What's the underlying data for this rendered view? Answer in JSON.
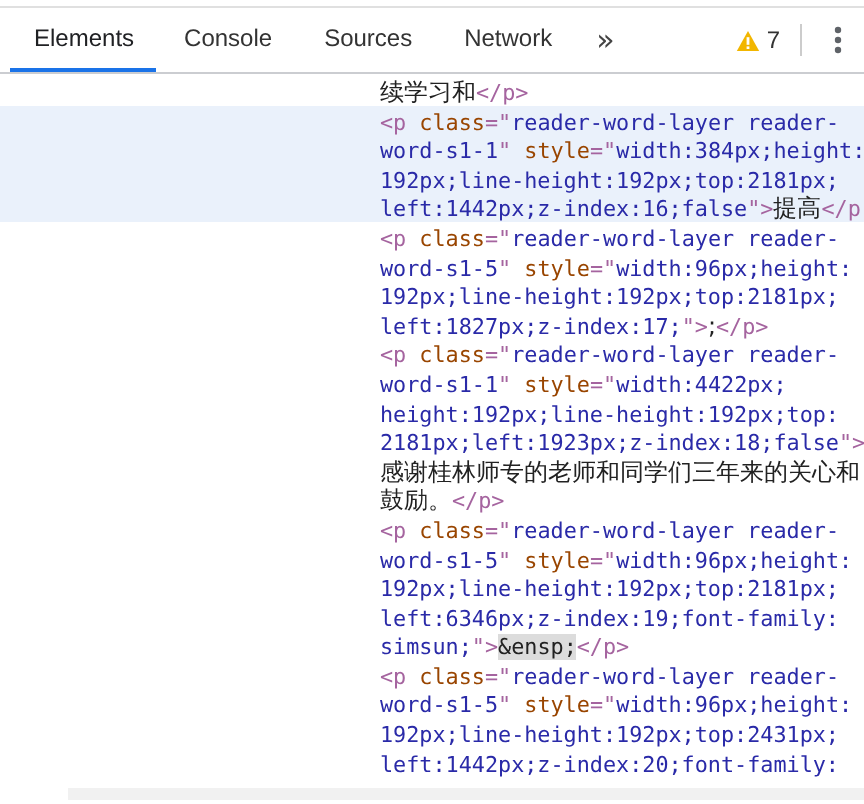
{
  "tabs": [
    {
      "label": "Elements",
      "selected": true
    },
    {
      "label": "Console",
      "selected": false
    },
    {
      "label": "Sources",
      "selected": false
    },
    {
      "label": "Network",
      "selected": false
    }
  ],
  "overflow_button": "»",
  "warnings": {
    "count": "7"
  },
  "nodes": [
    {
      "selected": false,
      "lines": [
        [
          {
            "kind": "text",
            "text": "续学习和"
          },
          {
            "kind": "tag",
            "text": "</p>"
          }
        ]
      ]
    },
    {
      "selected": true,
      "lines": [
        [
          {
            "kind": "tag",
            "text": "<p "
          },
          {
            "kind": "attr",
            "text": "class"
          },
          {
            "kind": "tag",
            "text": "=\""
          },
          {
            "kind": "val",
            "text": "reader-word-layer reader-"
          }
        ],
        [
          {
            "kind": "val",
            "text": "word-s1-1"
          },
          {
            "kind": "tag",
            "text": "\" "
          },
          {
            "kind": "attr",
            "text": "style"
          },
          {
            "kind": "tag",
            "text": "=\""
          },
          {
            "kind": "val",
            "text": "width:384px;height:"
          }
        ],
        [
          {
            "kind": "val",
            "text": "192px;line-height:192px;top:2181px;"
          }
        ],
        [
          {
            "kind": "val",
            "text": "left:1442px;z-index:16;false"
          },
          {
            "kind": "tag",
            "text": "\">"
          },
          {
            "kind": "text",
            "text": "提高"
          },
          {
            "kind": "tag",
            "text": "</p"
          }
        ]
      ]
    },
    {
      "selected": false,
      "lines": [
        [
          {
            "kind": "tag",
            "text": "<p "
          },
          {
            "kind": "attr",
            "text": "class"
          },
          {
            "kind": "tag",
            "text": "=\""
          },
          {
            "kind": "val",
            "text": "reader-word-layer reader-"
          }
        ],
        [
          {
            "kind": "val",
            "text": "word-s1-5"
          },
          {
            "kind": "tag",
            "text": "\" "
          },
          {
            "kind": "attr",
            "text": "style"
          },
          {
            "kind": "tag",
            "text": "=\""
          },
          {
            "kind": "val",
            "text": "width:96px;height:"
          }
        ],
        [
          {
            "kind": "val",
            "text": "192px;line-height:192px;top:2181px;"
          }
        ],
        [
          {
            "kind": "val",
            "text": "left:1827px;z-index:17;"
          },
          {
            "kind": "tag",
            "text": "\">"
          },
          {
            "kind": "text",
            "text": ";"
          },
          {
            "kind": "tag",
            "text": "</p>"
          }
        ]
      ]
    },
    {
      "selected": false,
      "lines": [
        [
          {
            "kind": "tag",
            "text": "<p "
          },
          {
            "kind": "attr",
            "text": "class"
          },
          {
            "kind": "tag",
            "text": "=\""
          },
          {
            "kind": "val",
            "text": "reader-word-layer reader-"
          }
        ],
        [
          {
            "kind": "val",
            "text": "word-s1-1"
          },
          {
            "kind": "tag",
            "text": "\" "
          },
          {
            "kind": "attr",
            "text": "style"
          },
          {
            "kind": "tag",
            "text": "=\""
          },
          {
            "kind": "val",
            "text": "width:4422px;"
          }
        ],
        [
          {
            "kind": "val",
            "text": "height:192px;line-height:192px;top:"
          }
        ],
        [
          {
            "kind": "val",
            "text": "2181px;left:1923px;z-index:18;false"
          },
          {
            "kind": "tag",
            "text": "\">"
          }
        ],
        [
          {
            "kind": "text",
            "text": "感谢桂林师专的老师和同学们三年来的关心和"
          }
        ],
        [
          {
            "kind": "text",
            "text": "鼓励。"
          },
          {
            "kind": "tag",
            "text": "</p>"
          }
        ]
      ]
    },
    {
      "selected": false,
      "lines": [
        [
          {
            "kind": "tag",
            "text": "<p "
          },
          {
            "kind": "attr",
            "text": "class"
          },
          {
            "kind": "tag",
            "text": "=\""
          },
          {
            "kind": "val",
            "text": "reader-word-layer reader-"
          }
        ],
        [
          {
            "kind": "val",
            "text": "word-s1-5"
          },
          {
            "kind": "tag",
            "text": "\" "
          },
          {
            "kind": "attr",
            "text": "style"
          },
          {
            "kind": "tag",
            "text": "=\""
          },
          {
            "kind": "val",
            "text": "width:96px;height:"
          }
        ],
        [
          {
            "kind": "val",
            "text": "192px;line-height:192px;top:2181px;"
          }
        ],
        [
          {
            "kind": "val",
            "text": "left:6346px;z-index:19;font-family:"
          }
        ],
        [
          {
            "kind": "val",
            "text": "simsun;"
          },
          {
            "kind": "tag",
            "text": "\">"
          },
          {
            "kind": "entity",
            "text": "&ensp;"
          },
          {
            "kind": "tag",
            "text": "</p>"
          }
        ]
      ]
    },
    {
      "selected": false,
      "lines": [
        [
          {
            "kind": "tag",
            "text": "<p "
          },
          {
            "kind": "attr",
            "text": "class"
          },
          {
            "kind": "tag",
            "text": "=\""
          },
          {
            "kind": "val",
            "text": "reader-word-layer reader-"
          }
        ],
        [
          {
            "kind": "val",
            "text": "word-s1-5"
          },
          {
            "kind": "tag",
            "text": "\" "
          },
          {
            "kind": "attr",
            "text": "style"
          },
          {
            "kind": "tag",
            "text": "=\""
          },
          {
            "kind": "val",
            "text": "width:96px;height:"
          }
        ],
        [
          {
            "kind": "val",
            "text": "192px;line-height:192px;top:2431px;"
          }
        ],
        [
          {
            "kind": "val",
            "text": "left:1442px;z-index:20;font-family:"
          }
        ]
      ]
    }
  ]
}
